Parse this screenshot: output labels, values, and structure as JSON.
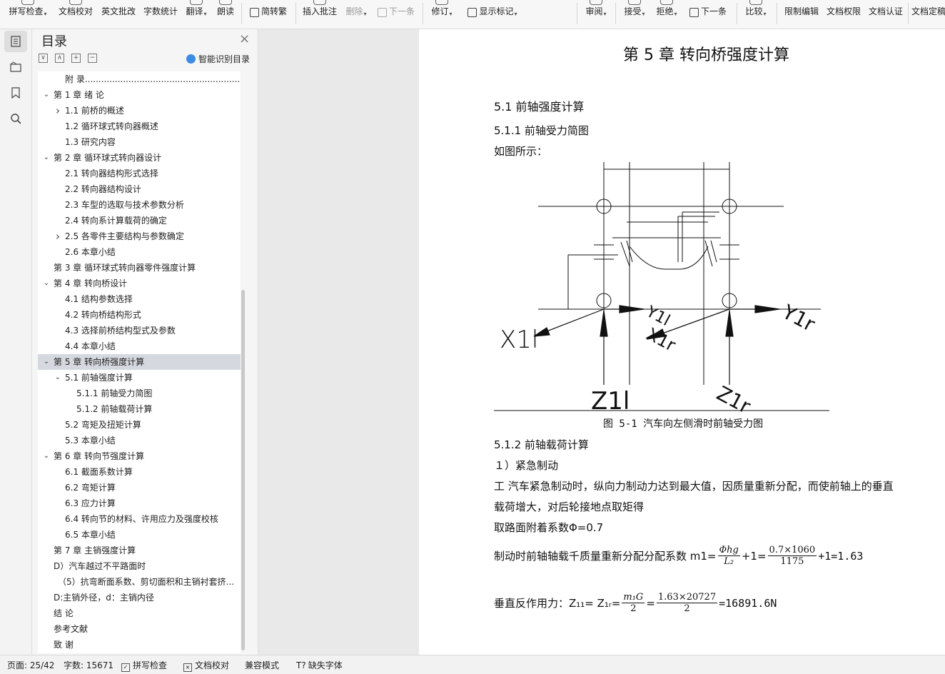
{
  "toolbar": {
    "spell_check": "拼写检查",
    "doc_proofread": "文档校对",
    "english_review": "英文批改",
    "word_count": "字数统计",
    "translate": "翻译",
    "read_aloud": "朗读",
    "simp_trad": "简转繁",
    "insert_comment": "插入批注",
    "delete": "删除",
    "next_comment": "下一条",
    "revise": "修订",
    "show_marks": "显示标记",
    "review": "审阅",
    "accept": "接受",
    "reject": "拒绝",
    "next_change": "下一条",
    "compare": "比较",
    "restrict_edit": "限制编辑",
    "doc_permission": "文档权限",
    "doc_certify": "文档认证",
    "doc_finalize": "文档定稿"
  },
  "toc": {
    "title": "目录",
    "smart_label": "智能识别目录",
    "items": [
      {
        "text": "附    录.......................................................................",
        "level": 1,
        "arrow": ""
      },
      {
        "text": "第 1 章  绪    论",
        "level": 0,
        "arrow": "down"
      },
      {
        "text": "1.1 前桥的概述",
        "level": 1,
        "arrow": "right"
      },
      {
        "text": "1.2 循环球式转向器概述",
        "level": 1,
        "arrow": ""
      },
      {
        "text": "1.3 研究内容",
        "level": 1,
        "arrow": ""
      },
      {
        "text": "第 2 章  循环球式转向器设计",
        "level": 0,
        "arrow": "down"
      },
      {
        "text": "2.1 转向器结构形式选择",
        "level": 1,
        "arrow": ""
      },
      {
        "text": "2.2 转向器结构设计",
        "level": 1,
        "arrow": ""
      },
      {
        "text": "2.3 车型的选取与技术参数分析",
        "level": 1,
        "arrow": ""
      },
      {
        "text": "2.4 转向系计算载荷的确定",
        "level": 1,
        "arrow": ""
      },
      {
        "text": "2.5 各零件主要结构与参数确定",
        "level": 1,
        "arrow": "right"
      },
      {
        "text": "2.6 本章小结",
        "level": 1,
        "arrow": ""
      },
      {
        "text": "第 3 章  循环球式转向器零件强度计算",
        "level": 0,
        "arrow": ""
      },
      {
        "text": "第 4 章  转向桥设计",
        "level": 0,
        "arrow": "down"
      },
      {
        "text": "4.1 结构参数选择",
        "level": 1,
        "arrow": ""
      },
      {
        "text": "4.2 转向桥结构形式",
        "level": 1,
        "arrow": ""
      },
      {
        "text": "4.3 选择前桥结构型式及参数",
        "level": 1,
        "arrow": ""
      },
      {
        "text": "4.4 本章小结",
        "level": 1,
        "arrow": ""
      },
      {
        "text": "第 5 章  转向桥强度计算",
        "level": 0,
        "arrow": "down"
      },
      {
        "text": "5.1 前轴强度计算",
        "level": 1,
        "arrow": "down"
      },
      {
        "text": "5.1.1 前轴受力简图",
        "level": 2,
        "arrow": ""
      },
      {
        "text": "5.1.2 前轴载荷计算",
        "level": 2,
        "arrow": ""
      },
      {
        "text": "5.2 弯矩及扭矩计算",
        "level": 1,
        "arrow": ""
      },
      {
        "text": "5.3 本章小结",
        "level": 1,
        "arrow": ""
      },
      {
        "text": "第 6 章  转向节强度计算",
        "level": 0,
        "arrow": "down"
      },
      {
        "text": "6.1 截面系数计算",
        "level": 1,
        "arrow": ""
      },
      {
        "text": "6.2 弯矩计算",
        "level": 1,
        "arrow": ""
      },
      {
        "text": "6.3 应力计算",
        "level": 1,
        "arrow": ""
      },
      {
        "text": "6.4 转向节的材料、许用应力及强度校核",
        "level": 1,
        "arrow": ""
      },
      {
        "text": "6.5 本章小结",
        "level": 1,
        "arrow": ""
      },
      {
        "text": "第 7 章  主销强度计算",
        "level": 0,
        "arrow": ""
      },
      {
        "text": "D）汽车越过不平路面时",
        "level": 0,
        "arrow": ""
      },
      {
        "text": "（5）抗弯断面系数、剪切面积和主销衬套挤...",
        "level": 0,
        "arrow": "",
        "extra_indent": true
      },
      {
        "text": "D:主销外径，d：主销内径",
        "level": 0,
        "arrow": ""
      },
      {
        "text": "结    论",
        "level": 0,
        "arrow": ""
      },
      {
        "text": "参考文献",
        "level": 0,
        "arrow": ""
      },
      {
        "text": "致    谢",
        "level": 0,
        "arrow": ""
      }
    ],
    "selected_index": 18
  },
  "doc": {
    "chapter_title": "第 5 章  转向桥强度计算",
    "sec_5_1": "5.1 前轴强度计算",
    "sec_5_1_1": "5.1.1 前轴受力简图",
    "as_shown": "如图所示：",
    "fig_caption": "图 5-1 汽车向左侧滑时前轴受力图",
    "fig_labels": {
      "x1l": "X1l",
      "y1l": "Y1l",
      "x1r": "X1r",
      "y1r": "Y1r",
      "z1l": "Z1l",
      "z1r": "Z1r"
    },
    "sec_5_1_2": "5.1.2 前轴载荷计算",
    "item1": "１）紧急制动",
    "para1_line1": "工  汽车紧急制动时，纵向力制动力达到最大值，因质量重新分配，而使前轴上的垂直",
    "para1_line2": "载荷增大，对后轮接地点取矩得",
    "para2": "取路面附着系数Φ=0.7",
    "eq1_prefix": "制动时前轴轴载千质量重新分配分配系数 m1=",
    "eq1_frac1_num": "Φhg",
    "eq1_frac1_den": "L₂",
    "eq1_plus": "+1=",
    "eq1_frac2_num": "0.7×1060",
    "eq1_frac2_den": "1175",
    "eq1_result": "+1=1.63",
    "eq2_prefix": "垂直反作用力：Z₁₁=  Z₁ᵣ=",
    "eq2_frac1_num": "m₁G",
    "eq2_frac1_den": "2",
    "eq2_eq": "=",
    "eq2_frac2_num": "1.63×20727",
    "eq2_frac2_den": "2",
    "eq2_result": "=16891.6N"
  },
  "status": {
    "page": "页面: 25/42",
    "words": "字数: 15671",
    "spell": "拼写检查",
    "proof": "文档校对",
    "compat": "兼容模式",
    "missing_font": "缺失字体"
  }
}
